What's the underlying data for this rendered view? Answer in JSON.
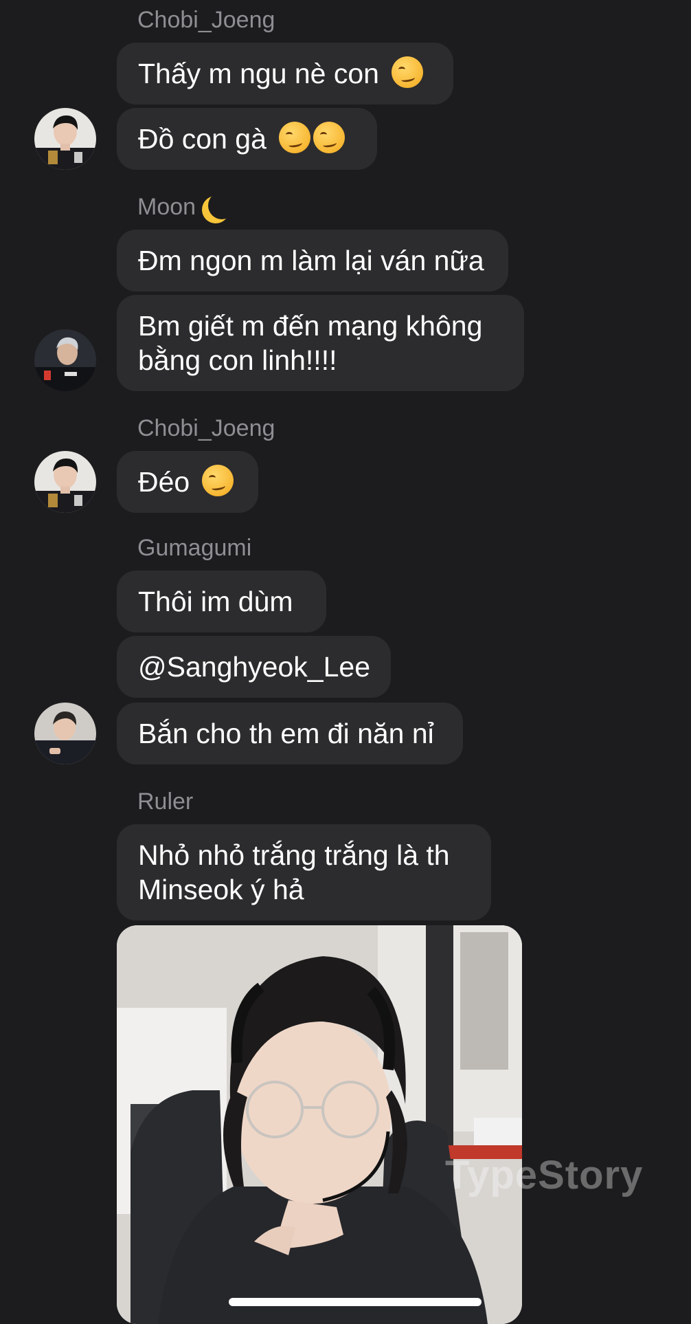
{
  "messages": [
    {
      "sender": "Chobi_Joeng",
      "bubbles": [
        "Thấy m ngu nè con",
        "Đồ con gà"
      ],
      "emojis": [
        "smirking-face",
        "smirking-face x2"
      ]
    },
    {
      "sender": "Moon",
      "sender_emoji": "crescent-moon",
      "bubbles": [
        "Đm ngon m làm lại ván nữa",
        "Bm giết m đến mạng không bằng con linh!!!!"
      ]
    },
    {
      "sender": "Chobi_Joeng",
      "bubbles": [
        "Đéo"
      ],
      "emojis": [
        "winking-face"
      ]
    },
    {
      "sender": "Gumagumi",
      "bubbles": [
        "Thôi im dùm",
        "@Sanghyeok_Lee",
        "Bắn cho th em đi năn nỉ"
      ]
    },
    {
      "sender": "Ruler",
      "bubbles": [
        "Nhỏ nhỏ trắng trắng là th Minseok ý hả"
      ],
      "attachment": "photo"
    }
  ],
  "watermark": "TypeStory",
  "colors": {
    "background": "#1c1c1e",
    "bubble": "#2c2c2e",
    "sender_name": "#8e8e93",
    "text": "#ffffff"
  }
}
